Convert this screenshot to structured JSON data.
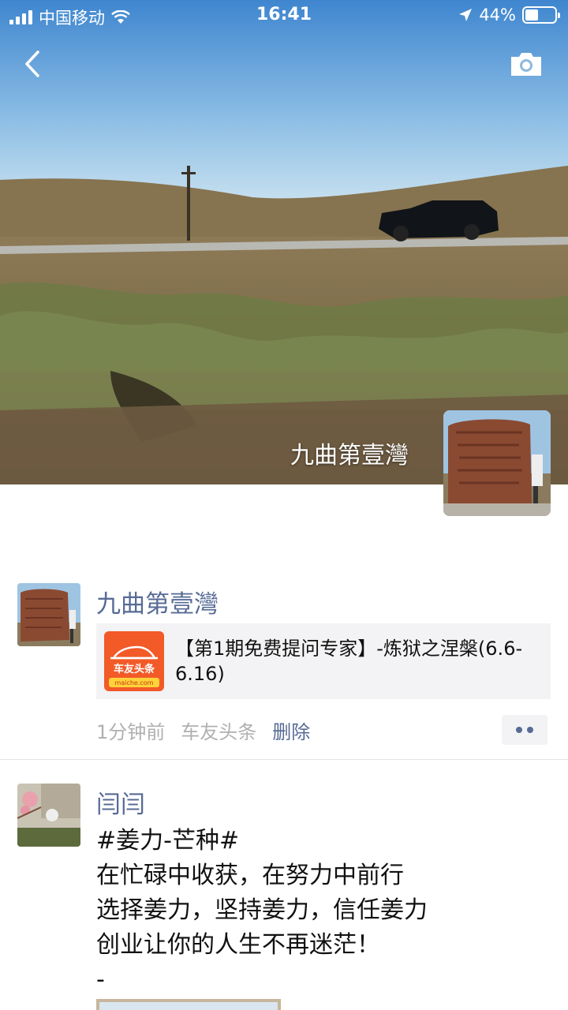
{
  "status_bar": {
    "carrier": "中国移动",
    "time": "16:41",
    "battery": "44%",
    "battery_level": 0.44
  },
  "nav": {
    "back_icon": "chevron-left-icon",
    "camera_icon": "camera-icon"
  },
  "cover": {
    "user_name": "九曲第壹灣"
  },
  "posts": [
    {
      "user_name": "九曲第壹灣",
      "link": {
        "title": "【第1期免费提问专家】-炼狱之涅槃(6.6-6.16)",
        "thumb_logo_text": "车友头条",
        "thumb_logo_sub": "maiche.com"
      },
      "time": "1分钟前",
      "source": "车友头条",
      "delete_label": "删除"
    },
    {
      "user_name": "闫闫",
      "text": "#姜力-芒种#\n在忙碌中收获，在努力中前行\n选择姜力，坚持姜力，信任姜力\n创业让你的人生不再迷茫！\n-"
    }
  ],
  "colors": {
    "link_blue": "#576b95",
    "meta_gray": "#b0b0b0",
    "card_bg": "#f3f3f5",
    "logo_orange": "#f25a28"
  }
}
